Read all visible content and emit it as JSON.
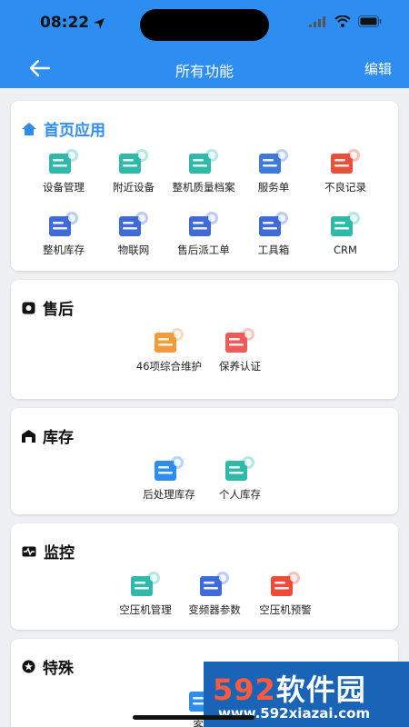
{
  "status": {
    "time": "08:22"
  },
  "nav": {
    "title": "所有功能",
    "edit": "编辑"
  },
  "sections": [
    {
      "title": "首页应用",
      "items": [
        {
          "label": "设备管理",
          "icon": "device-manage-icon",
          "color": "#2fb9a9"
        },
        {
          "label": "附近设备",
          "icon": "nearby-device-icon",
          "color": "#2fb9a9"
        },
        {
          "label": "整机质量档案",
          "icon": "quality-archive-icon",
          "color": "#2fb9a9"
        },
        {
          "label": "服务单",
          "icon": "service-order-icon",
          "color": "#3f7ad8"
        },
        {
          "label": "不良记录",
          "icon": "defect-record-icon",
          "color": "#e9503a"
        },
        {
          "label": "整机库存",
          "icon": "machine-stock-icon",
          "color": "#3f6ad8"
        },
        {
          "label": "物联网",
          "icon": "iot-icon",
          "color": "#3f6ad8"
        },
        {
          "label": "售后派工单",
          "icon": "dispatch-order-icon",
          "color": "#3f6ad8"
        },
        {
          "label": "工具箱",
          "icon": "toolbox-icon",
          "color": "#3f6ad8"
        },
        {
          "label": "CRM",
          "icon": "crm-icon",
          "color": "#2fb9a9"
        }
      ]
    },
    {
      "title": "售后",
      "items": [
        {
          "label": "46项综合维护",
          "icon": "maintenance-icon",
          "color": "#f39a3a"
        },
        {
          "label": "保养认证",
          "icon": "certification-icon",
          "color": "#ef5a5a"
        }
      ]
    },
    {
      "title": "库存",
      "items": [
        {
          "label": "后处理库存",
          "icon": "post-process-stock-icon",
          "color": "#2e8df0"
        },
        {
          "label": "个人库存",
          "icon": "personal-stock-icon",
          "color": "#2fb9a9"
        }
      ]
    },
    {
      "title": "监控",
      "items": [
        {
          "label": "空压机管理",
          "icon": "compressor-manage-icon",
          "color": "#2fb9a9"
        },
        {
          "label": "变频器参数",
          "icon": "inverter-params-icon",
          "color": "#3f6ad8"
        },
        {
          "label": "空压机预警",
          "icon": "compressor-alarm-icon",
          "color": "#ef4a3a"
        }
      ]
    },
    {
      "title": "特殊",
      "items": [
        {
          "label": "客户",
          "icon": "customer-icon",
          "color": "#2e8df0"
        }
      ]
    }
  ],
  "watermark": {
    "big_prefix": "592",
    "big_suffix": "软件园",
    "small": "www.592xiazai.com"
  }
}
